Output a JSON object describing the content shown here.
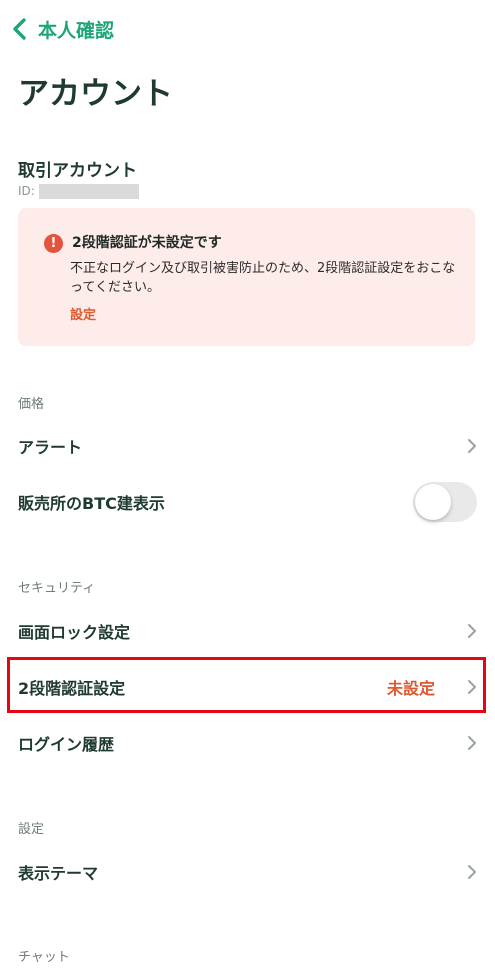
{
  "nav": {
    "back_label": "本人確認"
  },
  "page": {
    "title": "アカウント"
  },
  "account": {
    "label": "取引アカウント",
    "id_label": "ID:"
  },
  "alert": {
    "title": "2段階認証が未設定です",
    "body": "不正なログイン及び取引被害防止のため、2段階認証設定をおこなってください。",
    "link": "設定",
    "icon_glyph": "!"
  },
  "sections": {
    "price": {
      "header": "価格",
      "alert_label": "アラート",
      "btc_label": "販売所のBTC建表示",
      "btc_enabled": false
    },
    "security": {
      "header": "セキュリティ",
      "screen_lock_label": "画面ロック設定",
      "two_factor_label": "2段階認証設定",
      "two_factor_status": "未設定",
      "login_history_label": "ログイン履歴"
    },
    "settings": {
      "header": "設定",
      "theme_label": "表示テーマ"
    },
    "chat": {
      "header": "チャット"
    }
  },
  "colors": {
    "accent": "#1fa57a",
    "warning": "#e0582f",
    "alert_bg": "#fdecea",
    "highlight_border": "#e30613"
  }
}
